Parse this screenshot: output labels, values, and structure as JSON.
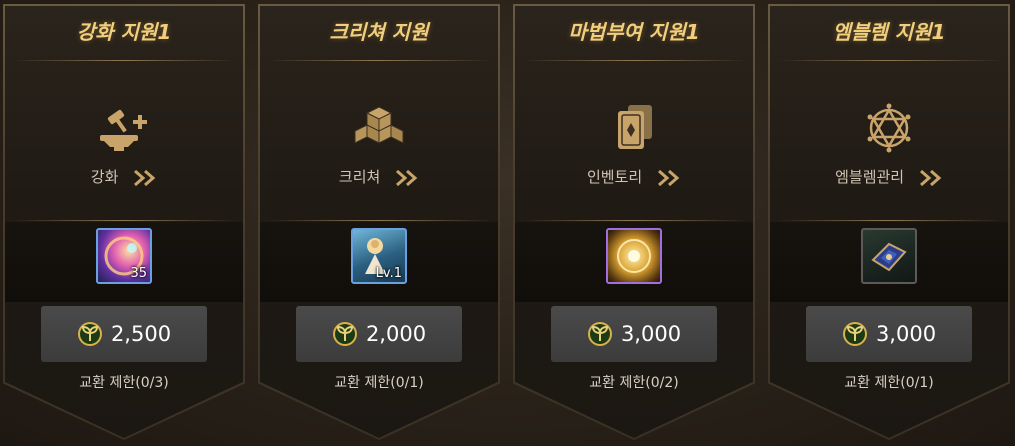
{
  "cards": [
    {
      "title": "강화 지원1",
      "shortcut_label": "강화",
      "shortcut_icon": "anvil-hammer-icon",
      "item_icon": "enhance-orb-icon",
      "item_count": "35",
      "price": "2,500",
      "limit": "교환 제한(0/3)"
    },
    {
      "title": "크리쳐 지원",
      "shortcut_label": "크리쳐",
      "shortcut_icon": "cubes-icon",
      "item_icon": "creature-card-icon",
      "item_count": "Lv.1",
      "price": "2,000",
      "limit": "교환 제한(0/1)"
    },
    {
      "title": "마법부여 지원1",
      "shortcut_label": "인벤토리",
      "shortcut_icon": "cards-icon",
      "item_icon": "enchant-orb-icon",
      "item_count": "",
      "price": "3,000",
      "limit": "교환 제한(0/2)"
    },
    {
      "title": "엠블렘 지원1",
      "shortcut_label": "엠블렘관리",
      "shortcut_icon": "hexagram-icon",
      "item_icon": "emblem-chest-icon",
      "item_count": "",
      "price": "3,000",
      "limit": "교환 제한(0/1)"
    }
  ],
  "currency_icon": "leaf-coin-icon",
  "colors": {
    "title_gold": "#f2cf7c",
    "item_border_blue": "#6aa0e0",
    "item_border_purple": "#a070e0",
    "item_border_dark": "#5a5a5a"
  }
}
